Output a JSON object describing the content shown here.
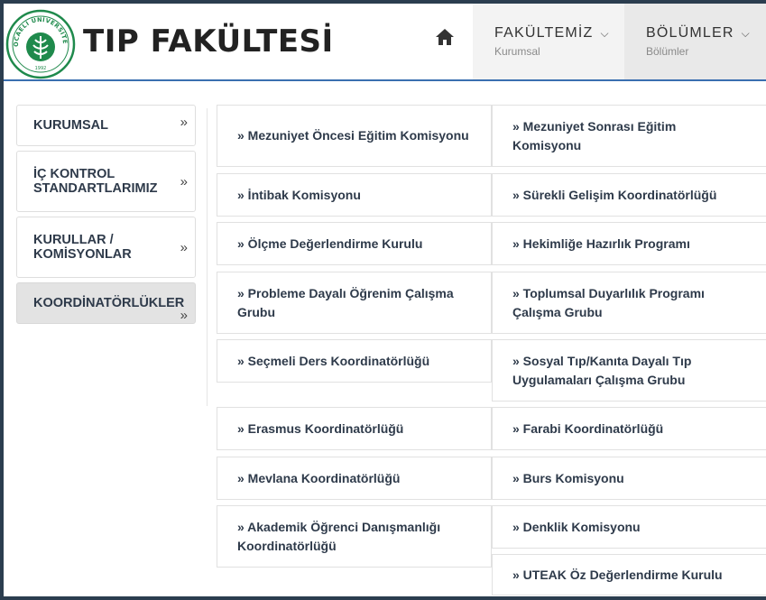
{
  "header": {
    "brand": "TIP FAKÜLTESİ",
    "logo_text": "KOCAELİ ÜNİVERSİTESİ",
    "logo_year": "1992",
    "nav": [
      {
        "label": "FAKÜLTEMİZ",
        "sub": "Kurumsal"
      },
      {
        "label": "BÖLÜMLER",
        "sub": "Bölümler"
      }
    ]
  },
  "sidebar": {
    "items": [
      {
        "label": "KURUMSAL"
      },
      {
        "label": "İÇ KONTROL STANDARTLARIMIZ"
      },
      {
        "label": "KURULLAR / KOMİSYONLAR"
      },
      {
        "label": "KOORDİNATÖRLÜKLER"
      }
    ]
  },
  "links": {
    "left": [
      "» Mezuniyet Öncesi Eğitim Komisyonu",
      "» İntibak Komisyonu",
      "» Ölçme Değerlendirme Kurulu",
      "» Probleme Dayalı Öğrenim Çalışma Grubu",
      "» Seçmeli Ders Koordinatörlüğü",
      "» Erasmus Koordinatörlüğü",
      "» Mevlana Koordinatörlüğü",
      "» Akademik Öğrenci Danışmanlığı Koordinatörlüğü"
    ],
    "right": [
      "» Mezuniyet Sonrası Eğitim Komisyonu",
      "» Sürekli Gelişim Koordinatörlüğü",
      "» Hekimliğe Hazırlık Programı",
      "» Toplumsal Duyarlılık Programı Çalışma Grubu",
      "» Sosyal Tıp/Kanıta Dayalı Tıp Uygulamaları Çalışma Grubu",
      "» Farabi Koordinatörlüğü",
      "» Burs Komisyonu",
      "» Denklik Komisyonu",
      "» UTEAK Öz Değerlendirme Kurulu"
    ]
  },
  "colors": {
    "logo_green": "#1f8a4c",
    "accent_blue": "#3a6fb0",
    "frame": "#2b3d4f"
  },
  "icons": {
    "home": "home-icon",
    "chevron": "chevron-down-icon",
    "raquo": "double-chevron-right-icon"
  }
}
